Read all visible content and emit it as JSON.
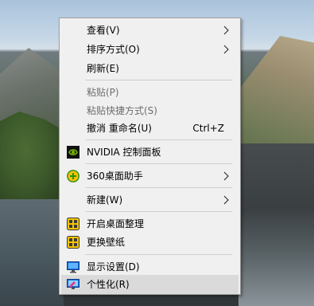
{
  "menu": {
    "items": [
      {
        "label": "查看(V)"
      },
      {
        "label": "排序方式(O)"
      },
      {
        "label": "刷新(E)"
      },
      {
        "label": "粘贴(P)"
      },
      {
        "label": "粘贴快捷方式(S)"
      },
      {
        "label": "撤消 重命名(U)",
        "shortcut": "Ctrl+Z"
      },
      {
        "label": "NVIDIA 控制面板",
        "icon": "nvidia-icon"
      },
      {
        "label": "360桌面助手",
        "icon": "360-desktop-assistant-icon"
      },
      {
        "label": "新建(W)"
      },
      {
        "label": "开启桌面整理",
        "icon": "desktop-organize-icon"
      },
      {
        "label": "更换壁纸",
        "icon": "wallpaper-change-icon"
      },
      {
        "label": "显示设置(D)",
        "icon": "display-settings-icon"
      },
      {
        "label": "个性化(R)",
        "icon": "personalize-icon"
      }
    ]
  },
  "colors": {
    "menu_background": "#f0f0f0",
    "highlight": "#dadada",
    "disabled_text": "#6d6d6d",
    "nvidia_green": "#76b900",
    "display_blue": "#1e6fd6"
  }
}
